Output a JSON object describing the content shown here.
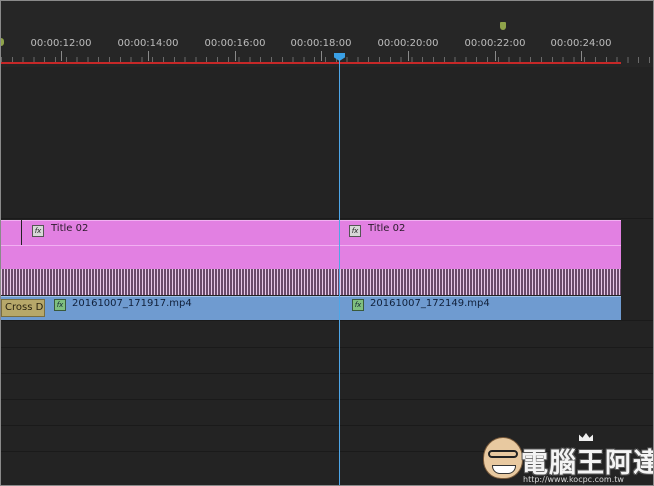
{
  "ruler": {
    "timecodes": [
      {
        "label": "00:00:12:00"
      },
      {
        "label": "00:00:14:00"
      },
      {
        "label": "00:00:16:00"
      },
      {
        "label": "00:00:18:00"
      },
      {
        "label": "00:00:20:00"
      },
      {
        "label": "00:00:22:00"
      },
      {
        "label": "00:00:24:00"
      }
    ]
  },
  "title_track": {
    "clips": [
      {
        "label": "Title 02",
        "fx": "fx"
      },
      {
        "label": "Title 02",
        "fx": "fx"
      }
    ]
  },
  "video_track": {
    "transition": "Cross D",
    "clips": [
      {
        "label": "20161007_171917.mp4",
        "fx": "fx"
      },
      {
        "label": "20161007_172149.mp4",
        "fx": "fx"
      }
    ]
  },
  "colors": {
    "title_clip": "#e280e2",
    "video_clip": "#6f9bd0",
    "playhead": "#3aa0e6",
    "work_area_bar": "#c62828"
  },
  "watermark": {
    "brand": "電腦王阿達",
    "url": "http://www.kocpc.com.tw"
  }
}
